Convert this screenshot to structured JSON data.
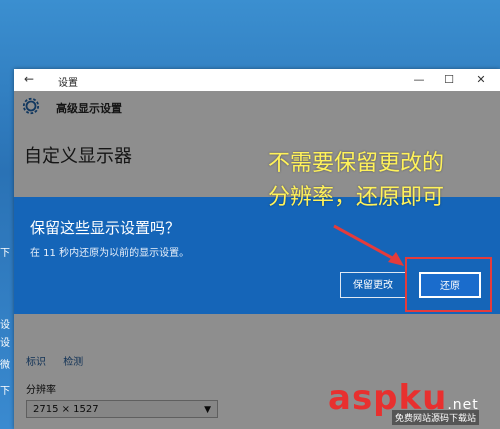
{
  "window": {
    "back": "←",
    "title": "设置",
    "minimize": "—",
    "maximize": "☐",
    "close": "✕"
  },
  "header": {
    "label": "高级显示设置"
  },
  "page": {
    "title": "自定义显示器",
    "links": [
      "标识",
      "检测"
    ],
    "resolution_label": "分辨率",
    "resolution_value": "2715 × 1527"
  },
  "left_strip": [
    "下",
    "设",
    "设",
    "微",
    "下"
  ],
  "dialog": {
    "question": "保留这些显示设置吗？",
    "subtext": "在 11 秒内还原为以前的显示设置。",
    "keep_button": "保留更改",
    "revert_button": "还原"
  },
  "annotation": {
    "line1": "不需要保留更改的",
    "line2": "分辨率，还原即可"
  },
  "watermark": {
    "brand": "aspku",
    "suffix": ".net",
    "subtitle": "免费网站源码下载站"
  },
  "colors": {
    "dialog_bg": "#1565b8",
    "annotation_text": "#fff25a",
    "highlight": "#e43b3b",
    "watermark": "#e8302f"
  }
}
